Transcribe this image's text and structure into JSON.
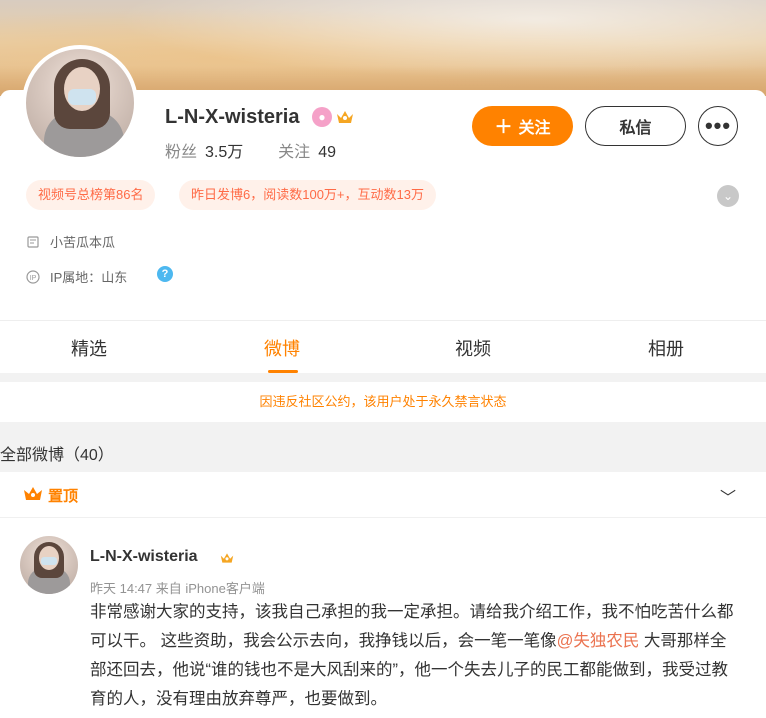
{
  "profile": {
    "name": "L-N-X-wisteria",
    "fans_label": "粉丝",
    "fans_value": "3.5万",
    "following_label": "关注",
    "following_value": "49",
    "follow_button": "关注",
    "message_button": "私信",
    "tags": [
      "视频号总榜第86名",
      "昨日发博6，阅读数100万+，互动数13万"
    ],
    "bio": "小苦瓜本瓜",
    "ip_location": "IP属地：山东",
    "ip_icon_text": "IP"
  },
  "tabs": [
    "精选",
    "微博",
    "视频",
    "相册"
  ],
  "active_tab": "微博",
  "notice": "因违反社区公约，该用户处于永久禁言状态",
  "all_weibo": "全部微博（40）",
  "pinned": {
    "label": "置顶"
  },
  "post": {
    "author": "L-N-X-wisteria",
    "meta": "昨天 14:47 来自 iPhone客户端",
    "text_before": "非常感谢大家的支持，该我自己承担的我一定承担。请给我介绍工作，我不怕吃苦什么都可以干。 这些资助，我会公示去向，我挣钱以后，会一笔一笔像",
    "mention": "@失独农民",
    "text_after": " 大哥那样全部还回去，他说“谁的钱也不是大风刮来的”，他一个失去儿子的民工都能做到，我受过教育的人，没有理由放弃尊严，也要做到。"
  },
  "colors": {
    "accent": "#ff8200",
    "tag_bg": "#fff1ea",
    "tag_text": "#ff6b47",
    "mention": "#eb7350"
  },
  "icons": [
    "more-icon",
    "chevron-down-icon",
    "bio-icon",
    "ip-icon",
    "help-icon",
    "crown-icon",
    "pinned-crown-icon",
    "vip-badge-icon"
  ]
}
